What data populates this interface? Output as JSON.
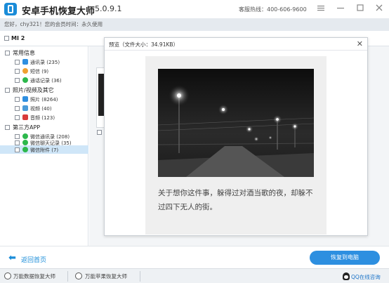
{
  "window": {
    "title": "安卓手机恢复大师",
    "version": "5.0.9.1",
    "hotline": "客服热线：400-606-9600",
    "menu_icon": "menu-icon",
    "minimize_icon": "minimize-icon",
    "maximize_icon": "maximize-icon",
    "close_icon": "close-icon"
  },
  "member_bar": {
    "text": "您好，chy321！您的会员时间：永久使用"
  },
  "device": {
    "name": "MI 2"
  },
  "sidebar": {
    "categories": [
      {
        "label": "常用信息",
        "items": [
          {
            "label": "通讯录 (235)",
            "icon": "contacts-icon",
            "color": "#2f8fe0"
          },
          {
            "label": "短信 (9)",
            "icon": "sms-icon",
            "color": "#f0a030"
          },
          {
            "label": "通话记录 (36)",
            "icon": "call-log-icon",
            "color": "#2db84c"
          }
        ]
      },
      {
        "label": "照片/视频及其它",
        "items": [
          {
            "label": "照片 (8264)",
            "icon": "photo-icon",
            "color": "#2f8fe0"
          },
          {
            "label": "视频 (40)",
            "icon": "video-icon",
            "color": "#4a9bd9"
          },
          {
            "label": "音频 (123)",
            "icon": "audio-icon",
            "color": "#d93b3b"
          }
        ]
      },
      {
        "label": "第三方APP",
        "items": [
          {
            "label": "微信通讯录 (208)",
            "icon": "wechat-icon",
            "color": "#2db84c"
          },
          {
            "label": "微信聊天记录 (35)",
            "icon": "wechat-icon",
            "color": "#2db84c"
          },
          {
            "label": "微信附件 (7)",
            "icon": "wechat-icon",
            "color": "#2db84c"
          }
        ]
      }
    ]
  },
  "preview": {
    "title": "预览（文件大小：34.91KB）",
    "caption": "关于想你这件事，躲得过对酒当歌的夜，却躲不过四下无人的街。"
  },
  "actions": {
    "back_label": "返回首页",
    "restore_label": "恢复到电脑"
  },
  "footer": {
    "items": [
      {
        "label": "万能数据恢复大师"
      },
      {
        "label": "万能苹果恢复大师"
      }
    ],
    "qq_label": "QQ在线咨询"
  },
  "colors": {
    "accent": "#2d8fe0",
    "selected_row": "#cfe6f8",
    "member_bar": "#e5eaef"
  }
}
